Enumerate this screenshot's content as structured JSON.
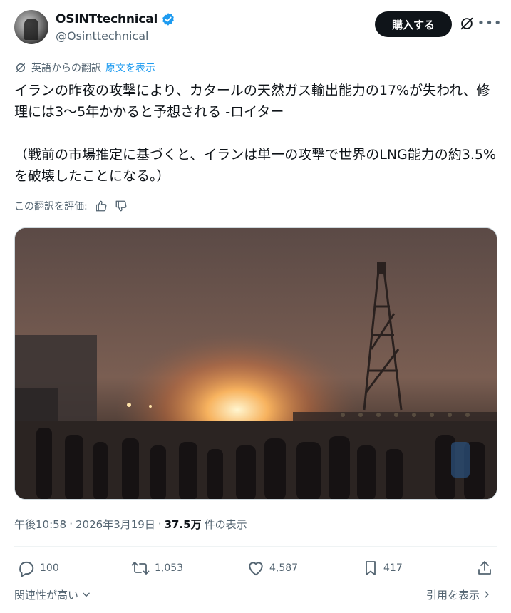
{
  "author": {
    "name": "OSINTtechnical",
    "handle": "@Osinttechnical",
    "verified_color": "#1d9bf0"
  },
  "header": {
    "buy_button_label": "購入する"
  },
  "translation": {
    "source_note": "英語からの翻訳",
    "show_original": "原文を表示",
    "rate_label": "この翻訳を評価:"
  },
  "tweet": {
    "text": "イランの昨夜の攻撃により、カタールの天然ガス輸出能力の17%が失われ、修理には3〜5年かかると予想される -ロイター\n\n（戦前の市場推定に基づくと、イランは単一の攻撃で世界のLNG能力の約3.5%を破壊したことになる。）"
  },
  "meta": {
    "time": "午後10:58",
    "sep1": "·",
    "date": "2026年3月19日",
    "sep2": "·",
    "views": "37.5万",
    "views_suffix": "件の表示"
  },
  "actions": {
    "replies": "100",
    "reposts": "1,053",
    "likes": "4,587",
    "bookmarks": "417"
  },
  "footer": {
    "relevance_label": "関連性が高い",
    "quotes_label": "引用を表示"
  },
  "colors": {
    "text_primary": "#0f1419",
    "text_secondary": "#536471",
    "link": "#1d9bf0",
    "button_bg": "#0f1419"
  }
}
